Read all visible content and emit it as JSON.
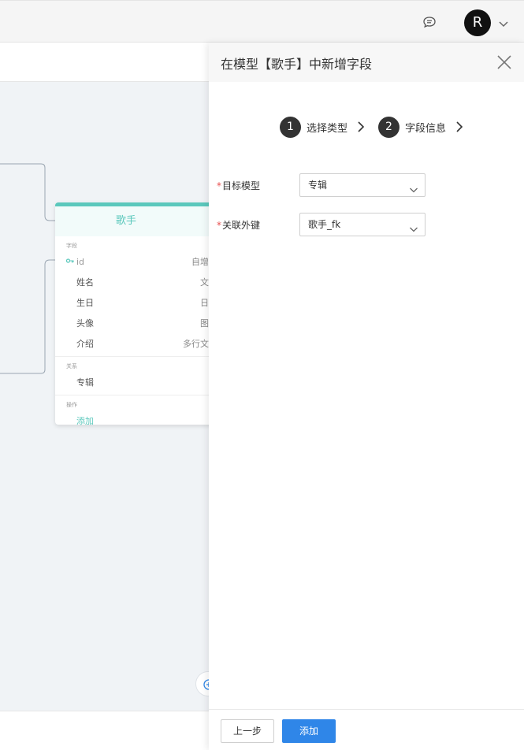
{
  "topbar": {
    "avatar_letter": "R",
    "icons": [
      "chat-icon",
      "chevron-down-icon"
    ]
  },
  "model_card": {
    "title": "歌手",
    "fields_section": "字段",
    "fields": [
      {
        "name": "id",
        "type": "自增"
      },
      {
        "name": "姓名",
        "type": "文"
      },
      {
        "name": "生日",
        "type": "日"
      },
      {
        "name": "头像",
        "type": "图"
      },
      {
        "name": "介绍",
        "type": "多行文"
      }
    ],
    "relations_section": "关系",
    "relations": [
      "专辑"
    ],
    "ops_section": "操作",
    "ops_add": "添加"
  },
  "drawer": {
    "title": "在模型【歌手】中新增字段",
    "steps": [
      {
        "num": "1",
        "label": "选择类型"
      },
      {
        "num": "2",
        "label": "字段信息"
      }
    ],
    "form": {
      "target_model": {
        "required": "*",
        "label": "目标模型",
        "value": "专辑"
      },
      "foreign_key": {
        "required": "*",
        "label": "关联外键",
        "value": "歌手_fk"
      }
    },
    "footer": {
      "prev_label": "上一步",
      "add_label": "添加"
    }
  },
  "colors": {
    "accent_teal": "#5bc8bc",
    "primary_blue": "#2f86e8",
    "required_red": "#e84e4e"
  }
}
